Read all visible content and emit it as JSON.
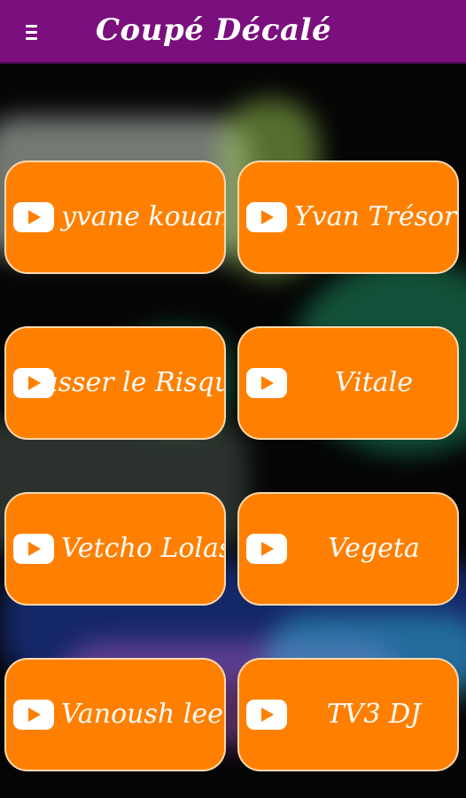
{
  "header": {
    "title": "Coupé Décalé",
    "menu_icon": "hamburger-menu-icon"
  },
  "colors": {
    "header_bg": "#7a0f7d",
    "button_bg": "#ff8000",
    "button_border": "#ffd9b0",
    "text": "#ffffff"
  },
  "items": [
    {
      "label": "yvane kouame",
      "icon": "play-icon"
    },
    {
      "label": "Yvan Trésor",
      "icon": "play-icon"
    },
    {
      "label": "Passer le Risque",
      "icon": "play-icon"
    },
    {
      "label": "Vitale",
      "icon": "play-icon"
    },
    {
      "label": "Vetcho Lolas",
      "icon": "play-icon"
    },
    {
      "label": "Vegeta",
      "icon": "play-icon"
    },
    {
      "label": "Vanoush lee",
      "icon": "play-icon"
    },
    {
      "label": "TV3 DJ",
      "icon": "play-icon"
    }
  ]
}
